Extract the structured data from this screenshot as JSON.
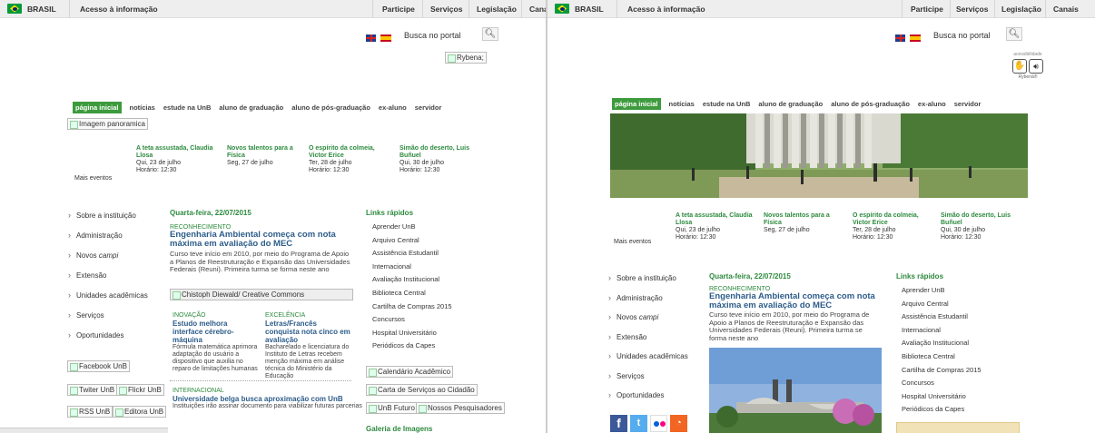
{
  "govbar": {
    "brasil": "BRASIL",
    "acesso": "Acesso à informação",
    "links": [
      "Participe",
      "Serviços",
      "Legislação",
      "Canais"
    ]
  },
  "search": {
    "label": "Busca no portal",
    "button_icon": "search-icon"
  },
  "rybena": {
    "alt": "Rybena;",
    "caption_top": "acessibilidade",
    "caption_bottom": "Rybená®"
  },
  "nav": {
    "items": [
      "página inicial",
      "notícias",
      "estude na UnB",
      "aluno de graduação",
      "aluno de pós-graduação",
      "ex-aluno",
      "servidor"
    ]
  },
  "panorama_alt": "Imagem panoramica",
  "events": [
    {
      "title": "A teta assustada, Claudia Llosa",
      "date": "Qui, 23 de julho",
      "time": "Horário: 12:30"
    },
    {
      "title": "Novos talentos para a Física",
      "date": "Seg, 27 de julho",
      "time": ""
    },
    {
      "title": "O espírito da colmeia, Victor Erice",
      "date": "Ter, 28 de julho",
      "time": "Horário: 12:30"
    },
    {
      "title": "Simão do deserto, Luis Buñuel",
      "date": "Qui, 30 de julho",
      "time": "Horário: 12:30"
    }
  ],
  "mais_eventos": "Mais eventos",
  "menu": [
    "Sobre a instituição",
    "Administração",
    "Novos campi",
    "Extensão",
    "Unidades acadêmicas",
    "Serviços",
    "Oportunidades"
  ],
  "news": {
    "date": "Quarta-feira, 22/07/2015",
    "main": {
      "tag": "RECONHECIMENTO",
      "headline": "Engenharia Ambiental começa com nota máxima em avaliação do MEC",
      "body": "Curso teve início em 2010, por meio do Programa de Apoio a Planos de Reestruturação e Expansão das Universidades Federais (Reuni). Primeira turma se forma neste ano"
    },
    "photo_alt": "Chistoph Diewald/ Creative Commons",
    "secondary": [
      {
        "tag": "INOVAÇÃO",
        "headline": "Estudo melhora interface cérebro-máquina",
        "body": "Fórmula matemática aprimora adaptação do usuário a dispositivo que auxilia no reparo de limitações humanas"
      },
      {
        "tag": "EXCELÊNCIA",
        "headline": "Letras/Francês conquista nota cinco em avaliação",
        "body": "Bacharelado e licenciatura do Instituto de Letras recebem menção máxima em análise técnica do Ministério da Educação"
      }
    ],
    "intl": {
      "tag": "INTERNACIONAL",
      "headline": "Universidade belga busca aproximação com UnB",
      "body": "Instituições irão assinar documento para viabilizar futuras parcerias"
    }
  },
  "quick_links": {
    "title": "Links rápidos",
    "items": [
      "Aprender UnB",
      "Arquivo Central",
      "Assistência Estudantil",
      "Internacional",
      "Avaliação Institucional",
      "Biblioteca Central",
      "Cartilha de Compras 2015",
      "Concursos",
      "Hospital Universitário",
      "Periódicos da Capes"
    ]
  },
  "social_alts": [
    "Facebook UnB",
    "Twiter UnB",
    "Flickr UnB",
    "RSS UnB",
    "Editora UnB"
  ],
  "banner_alts": [
    "Calendário Acadêmico",
    "Carta de Serviços ao Cidadão",
    "UnB Futuro",
    "Nossos Pesquisadores"
  ],
  "galeria": "Galeria de Imagens",
  "colors": {
    "green": "#2d8a3e",
    "blue": "#2c5c8a",
    "nav_active": "#3d9b3d"
  }
}
